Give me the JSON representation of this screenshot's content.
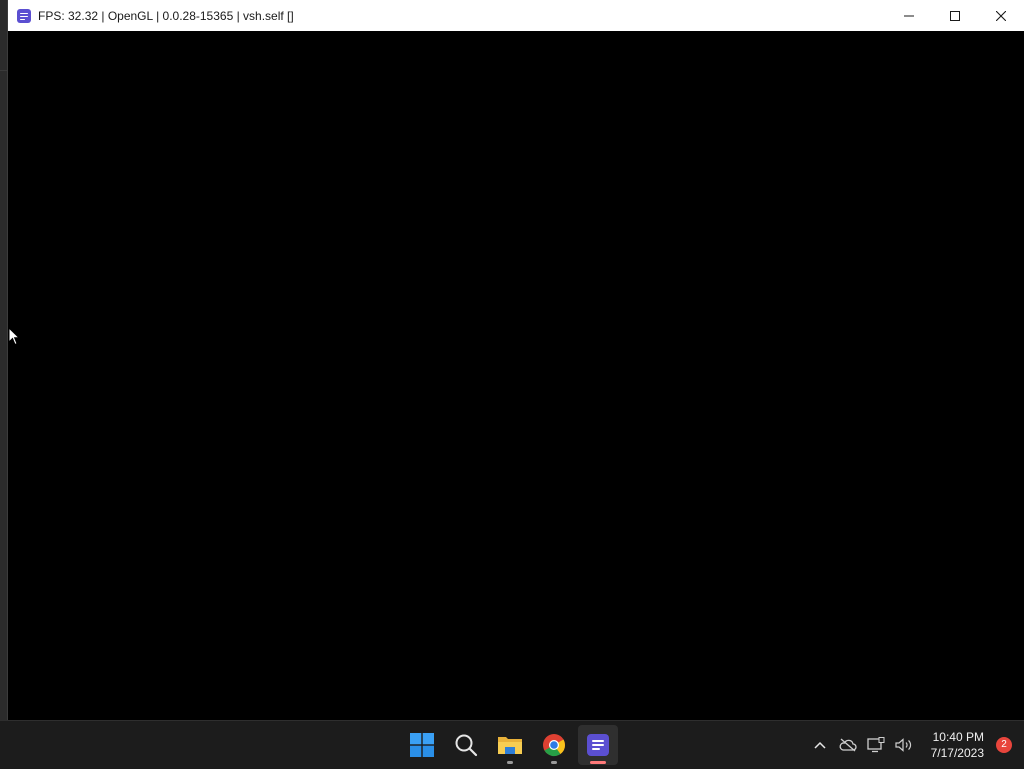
{
  "window": {
    "title": "FPS: 32.32 | OpenGL | 0.0.28-15365 | vsh.self []",
    "controls": {
      "minimize": "minimize",
      "maximize": "maximize",
      "close": "close"
    }
  },
  "taskbar": {
    "apps": [
      {
        "name": "Start",
        "icon": "windows-start-icon"
      },
      {
        "name": "Search",
        "icon": "search-icon"
      },
      {
        "name": "File Explorer",
        "icon": "folder-icon"
      },
      {
        "name": "Google Chrome",
        "icon": "chrome-icon"
      },
      {
        "name": "Emulator",
        "icon": "app-icon",
        "active": true
      }
    ],
    "tray": {
      "icons": [
        "chevron-up-icon",
        "cloud-offline-icon",
        "network-icon",
        "volume-icon"
      ],
      "time": "10:40 PM",
      "date": "7/17/2023",
      "notification_count": "2"
    }
  },
  "colors": {
    "accent": "#5b4fd1",
    "taskbar": "#1c1c1c",
    "notification": "#e8453c",
    "active_indicator": "#ff7a7a"
  }
}
